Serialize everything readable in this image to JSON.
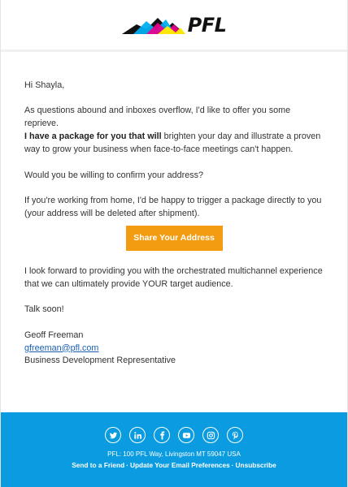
{
  "header": {
    "logo_text": "PFL",
    "logo_colors": [
      "#1b1b1b",
      "#00aeef",
      "#ec008c",
      "#fff200"
    ]
  },
  "email": {
    "greeting": "Hi Shayla,",
    "p1": "As questions abound and inboxes overflow, I'd like to offer you some reprieve.",
    "p2_bold": "I have a package for you that will",
    "p2_rest": " brighten your day and illustrate a proven way to grow your business when face-to-face meetings can't happen.",
    "p3": "Would you be willing to confirm your address?",
    "p4": "If you're working from home, I'd be happy to trigger a package directly to you (your address will be deleted after shipment).",
    "cta_label": "Share Your Address",
    "p5": "I look forward to providing you with the orchestrated multichannel experience that we can ultimately provide YOUR target audience.",
    "signoff": "Talk soon!",
    "sender_name": "Geoff Freeman",
    "sender_email": "gfreeman@pfl.com",
    "sender_title": "Business Development Representative"
  },
  "footer": {
    "social_icons": [
      "twitter-icon",
      "linkedin-icon",
      "facebook-icon",
      "youtube-icon",
      "instagram-icon",
      "pinterest-icon"
    ],
    "address": "PFL: 100 PFL Way, Livingston MT 59047 USA",
    "link_send": "Send to a Friend",
    "link_prefs": "Update Your Email Preferences",
    "link_unsub": "Unsubscribe",
    "separator": "·"
  },
  "colors": {
    "accent": "#f39c12",
    "footer_bg": "#0a9be0",
    "link": "#1a5fb4"
  }
}
